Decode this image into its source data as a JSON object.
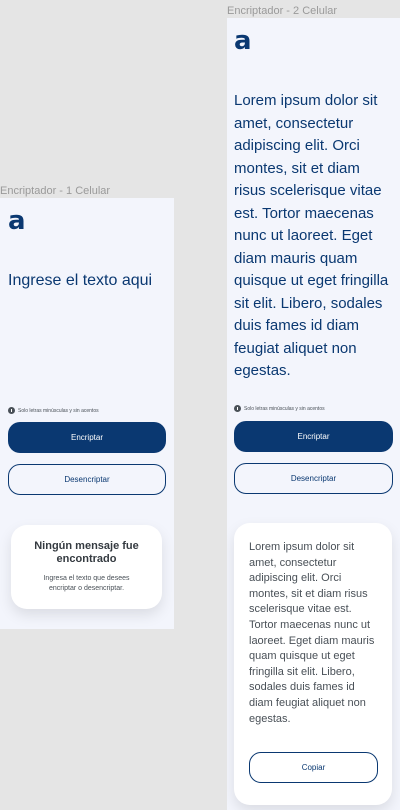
{
  "frame1": {
    "title": "Encriptador - 1 Celular",
    "logo": "a",
    "input_text": "Ingrese el texto aqui",
    "note": "Solo letras minúsculas y sin acentos",
    "encrypt_label": "Encriptar",
    "decrypt_label": "Desencriptar",
    "empty_title": "Ningún mensaje fue encontrado",
    "empty_subtitle": "Ingresa el texto que desees encriptar o desencriptar."
  },
  "frame2": {
    "title": "Encriptador - 2 Celular",
    "logo": "a",
    "input_text": "Lorem ipsum dolor sit amet, consectetur adipiscing elit. Orci montes, sit et diam risus scelerisque vitae est. Tortor maecenas nunc ut laoreet. Eget diam mauris quam quisque ut eget fringilla sit elit. Libero, sodales duis fames id diam feugiat aliquet non egestas.",
    "note": "Solo letras minúsculas y sin acentos",
    "encrypt_label": "Encriptar",
    "decrypt_label": "Desencriptar",
    "output_text": "Lorem ipsum dolor sit amet, consectetur adipiscing elit. Orci montes, sit et diam risus scelerisque vitae est. Tortor maecenas nunc ut laoreet. Eget diam mauris quam quisque ut eget fringilla sit elit. Libero, sodales duis fames id diam feugiat aliquet non egestas.",
    "copy_label": "Copiar"
  },
  "colors": {
    "brand": "#0a3871",
    "frame_bg": "#f3f5fc",
    "canvas_bg": "#e5e5e5",
    "muted_text": "#495057"
  },
  "icons": [
    "info-icon"
  ]
}
